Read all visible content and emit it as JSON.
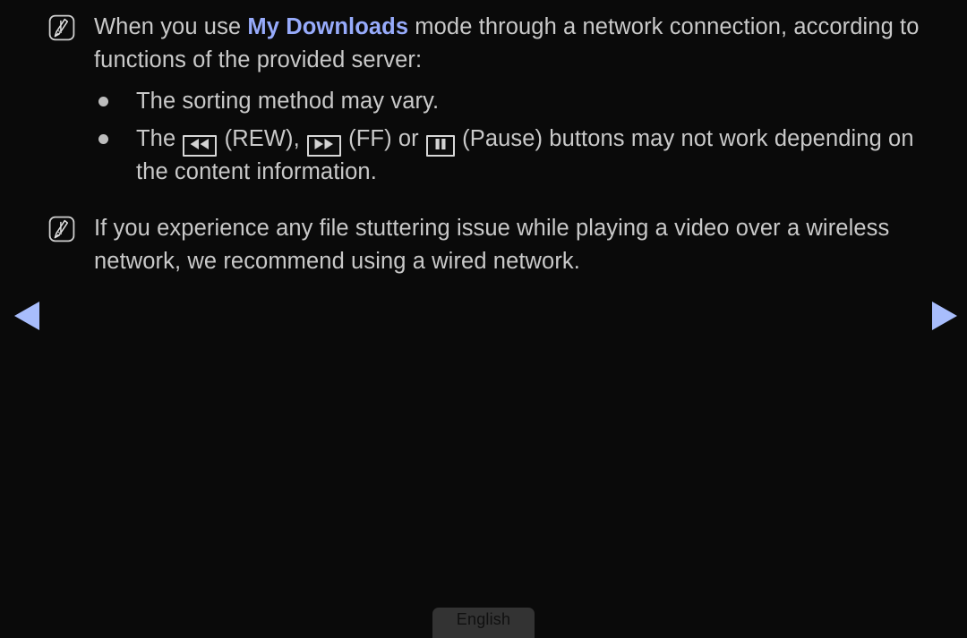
{
  "screen": {
    "background_color": "#0a0a0a",
    "body_text_color": "#c9c9c9",
    "highlight_color": "#97abfb",
    "arrow_color": "#a8bdfc"
  },
  "notes": [
    {
      "icon": "note-pen-icon",
      "text_before_highlight": "When you use ",
      "highlight": "My Downloads",
      "text_after_highlight": " mode through a network connection, according to functions of the provided server:"
    },
    {
      "icon": "note-pen-icon",
      "text": "If you experience any file stuttering issue while playing a video over a wireless network, we recommend using a wired network."
    }
  ],
  "bullets": [
    {
      "text": "The sorting method may vary."
    },
    {
      "lead": "The ",
      "key1": "rewind-key-icon",
      "label1": " (REW), ",
      "key2": "fast-forward-key-icon",
      "label2": " (FF) or ",
      "key3": "pause-key-icon",
      "label3": " (Pause) buttons may not work depending on the content information."
    }
  ],
  "navigation": {
    "previous_label": "previous-page-arrow",
    "next_label": "next-page-arrow"
  },
  "footer": {
    "language_label": "English"
  }
}
